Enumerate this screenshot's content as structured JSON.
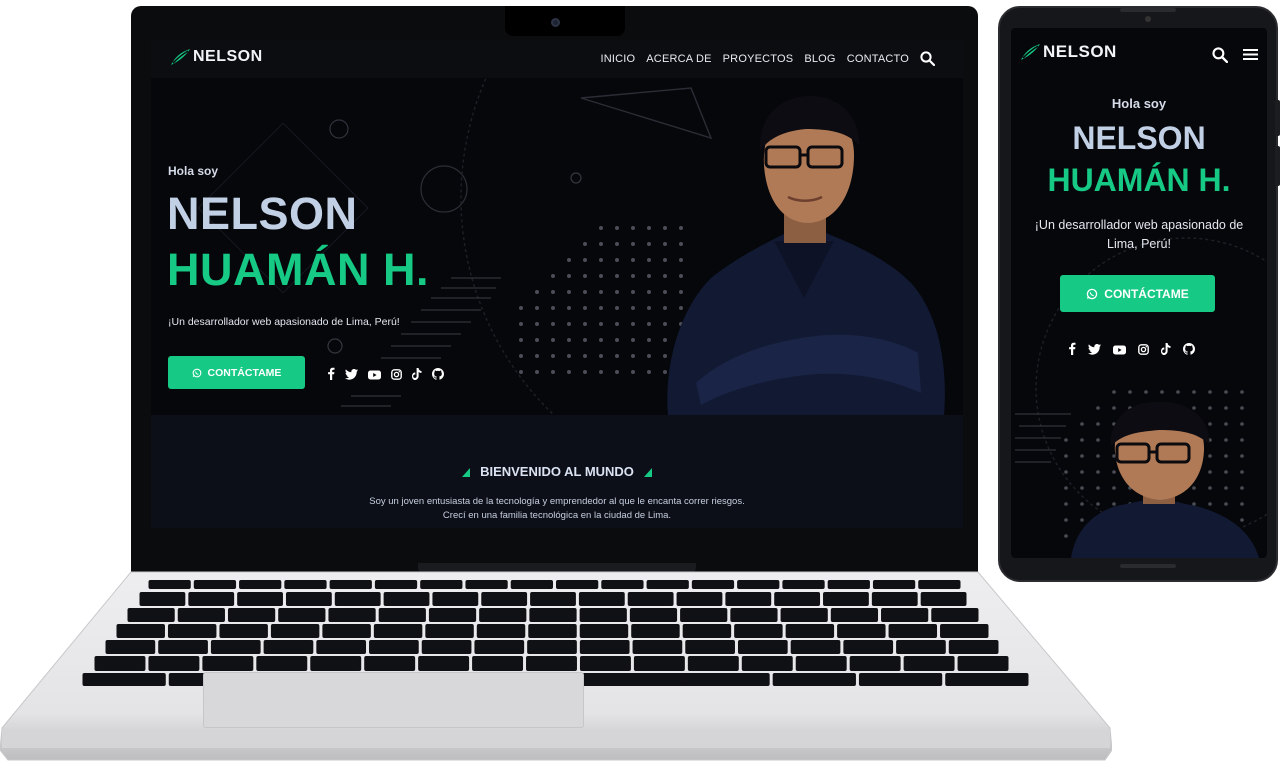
{
  "colors": {
    "accent": "#16c985",
    "name_primary": "#c2d0e6",
    "background": "#06070b",
    "nav_background": "#0c0d11",
    "welcome_background": "#0c0f18"
  },
  "laptop": {
    "logo_text": "NELSON",
    "nav": [
      "INICIO",
      "ACERCA DE",
      "PROYECTOS",
      "BLOG",
      "CONTACTO"
    ],
    "hero": {
      "greeting": "Hola soy",
      "name_line1": "NELSON",
      "name_line2": "HUAMÁN H.",
      "tagline": "¡Un desarrollador web apasionado de Lima, Perú!",
      "cta_label": "CONTÁCTAME",
      "cta_icon": "whatsapp-icon",
      "socials": [
        "facebook-icon",
        "twitter-icon",
        "youtube-icon",
        "instagram-icon",
        "tiktok-icon",
        "github-icon"
      ]
    },
    "welcome": {
      "title": "BIENVENIDO AL MUNDO",
      "text": "Soy un joven entusiasta de la tecnología y emprendedor al que le encanta correr riesgos. Crecí en una familia tecnológica en la ciudad de Lima."
    }
  },
  "phone": {
    "logo_text": "NELSON",
    "hero": {
      "greeting": "Hola soy",
      "name_line1": "NELSON",
      "name_line2": "HUAMÁN H.",
      "tagline": "¡Un desarrollador web apasionado de Lima, Perú!",
      "cta_label": "CONTÁCTAME",
      "cta_icon": "whatsapp-icon",
      "socials": [
        "facebook-icon",
        "twitter-icon",
        "youtube-icon",
        "instagram-icon",
        "tiktok-icon",
        "github-icon"
      ]
    }
  }
}
